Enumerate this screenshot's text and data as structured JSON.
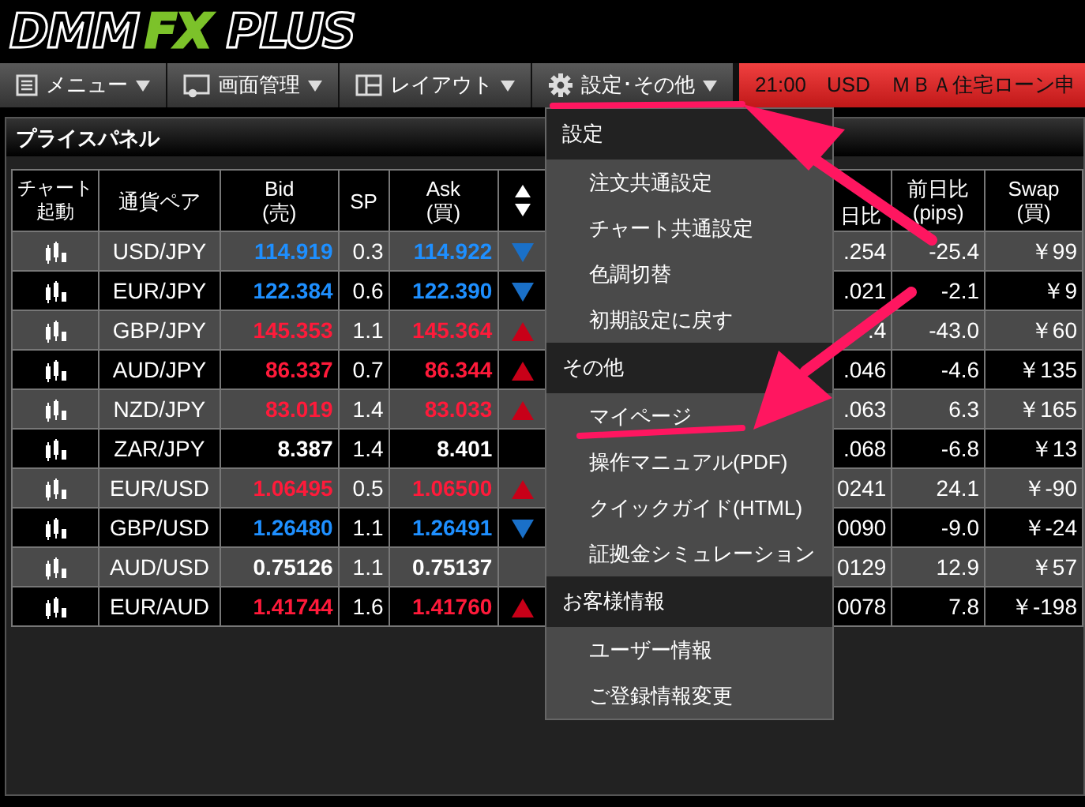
{
  "logo": {
    "parts": [
      {
        "text": "DMM",
        "kind": "plain"
      },
      {
        "text": "FX",
        "kind": "accent"
      },
      {
        "text": "PLUS",
        "kind": "plain"
      }
    ]
  },
  "toolbar": {
    "buttons": [
      {
        "label": "メニュー"
      },
      {
        "label": "画面管理"
      },
      {
        "label": "レイアウト"
      },
      {
        "label": "設定･その他"
      }
    ],
    "ticker": "21:00　USD　ＭＢＡ住宅ローン申"
  },
  "panel": {
    "title": "プライスパネル",
    "table": {
      "columns": [
        "チャート起動",
        "通貨ペア",
        "Bid\n(売)",
        "SP",
        "Ask\n(買)",
        "",
        "日比",
        "前日比\n(pips)",
        "Swap\n(買)"
      ],
      "rows": [
        {
          "pair": "USD/JPY",
          "bid": "114.919",
          "sp": "0.3",
          "ask": "114.922",
          "up": false,
          "down": true,
          "column_7": ".254",
          "pips": "-25.4",
          "swap": "￥99"
        },
        {
          "pair": "EUR/JPY",
          "bid": "122.384",
          "sp": "0.6",
          "ask": "122.390",
          "up": false,
          "down": true,
          "column_7": ".021",
          "pips": "-2.1",
          "swap": "￥9"
        },
        {
          "pair": "GBP/JPY",
          "bid": "145.353",
          "sp": "1.1",
          "ask": "145.364",
          "up": true,
          "down": false,
          "column_7": ".4",
          "pips": "-43.0",
          "swap": "￥60"
        },
        {
          "pair": "AUD/JPY",
          "bid": "86.337",
          "sp": "0.7",
          "ask": "86.344",
          "up": true,
          "down": false,
          "column_7": ".046",
          "pips": "-4.6",
          "swap": "￥135"
        },
        {
          "pair": "NZD/JPY",
          "bid": "83.019",
          "sp": "1.4",
          "ask": "83.033",
          "up": true,
          "down": false,
          "column_7": ".063",
          "pips": "6.3",
          "swap": "￥165"
        },
        {
          "pair": "ZAR/JPY",
          "bid": "8.387",
          "sp": "1.4",
          "ask": "8.401",
          "up": false,
          "down": false,
          "column_7": ".068",
          "pips": "-6.8",
          "swap": "￥13"
        },
        {
          "pair": "EUR/USD",
          "bid": "1.06495",
          "sp": "0.5",
          "ask": "1.06500",
          "up": true,
          "down": false,
          "column_7": "0241",
          "pips": "24.1",
          "swap": "￥-90"
        },
        {
          "pair": "GBP/USD",
          "bid": "1.26480",
          "sp": "1.1",
          "ask": "1.26491",
          "up": false,
          "down": true,
          "column_7": "0090",
          "pips": "-9.0",
          "swap": "￥-24"
        },
        {
          "pair": "AUD/USD",
          "bid": "0.75126",
          "sp": "1.1",
          "ask": "0.75137",
          "up": false,
          "down": false,
          "column_7": "0129",
          "pips": "12.9",
          "swap": "￥57"
        },
        {
          "pair": "EUR/AUD",
          "bid": "1.41744",
          "sp": "1.6",
          "ask": "1.41760",
          "up": true,
          "down": false,
          "column_7": "0078",
          "pips": "7.8",
          "swap": "￥-198"
        }
      ]
    }
  },
  "dropdown_menu": {
    "items": [
      {
        "kind": "header",
        "label": "設定"
      },
      {
        "kind": "item",
        "label": "注文共通設定"
      },
      {
        "kind": "item",
        "label": "チャート共通設定"
      },
      {
        "kind": "item",
        "label": "色調切替"
      },
      {
        "kind": "item",
        "label": "初期設定に戻す"
      },
      {
        "kind": "header",
        "label": "その他"
      },
      {
        "kind": "item",
        "label": "マイページ"
      },
      {
        "kind": "item",
        "label": "操作マニュアル(PDF)"
      },
      {
        "kind": "item",
        "label": "クイックガイド(HTML)"
      },
      {
        "kind": "item",
        "label": "証拠金シミュレーション"
      },
      {
        "kind": "header",
        "label": "お客様情報"
      },
      {
        "kind": "item",
        "label": "ユーザー情報"
      },
      {
        "kind": "item",
        "label": "ご登録情報変更"
      }
    ]
  }
}
